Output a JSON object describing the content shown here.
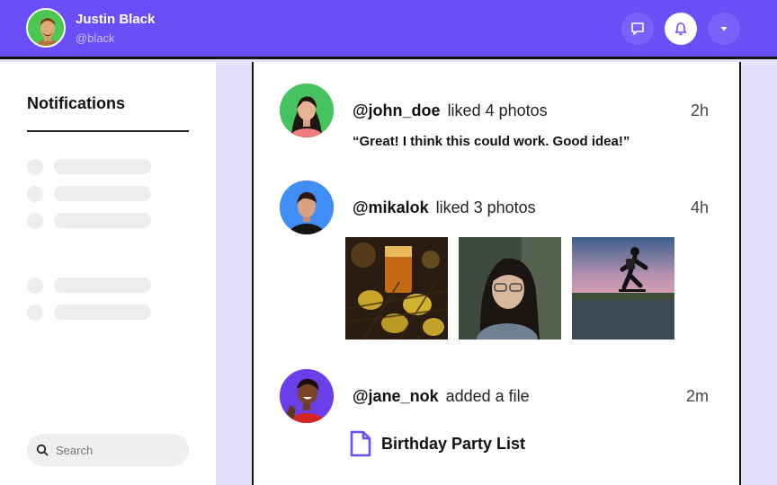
{
  "header": {
    "user_name": "Justin Black",
    "user_handle": "@black",
    "icons": [
      "message-icon",
      "bell-icon",
      "chevron-down-icon"
    ],
    "accent_color": "#6c4ef8"
  },
  "sidebar": {
    "title": "Notifications",
    "search_placeholder": "Search"
  },
  "notifications": [
    {
      "handle": "@john_doe",
      "action": "liked 4 photos",
      "time": "2h",
      "comment": "“Great! I think this could work. Good idea!”"
    },
    {
      "handle": "@mikalok",
      "action": "liked 3 photos",
      "time": "4h"
    },
    {
      "handle": "@jane_nok",
      "action": "added a file",
      "time": "2m",
      "file_name": "Birthday Party List"
    }
  ]
}
